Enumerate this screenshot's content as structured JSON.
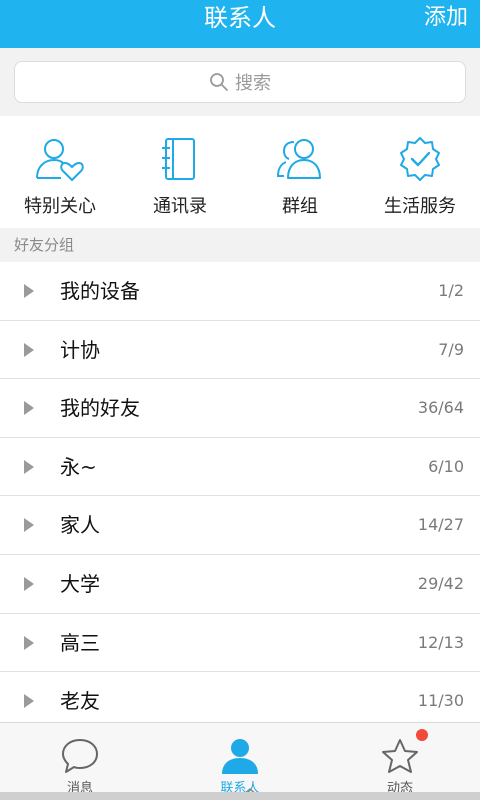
{
  "header": {
    "title": "联系人",
    "add_label": "添加"
  },
  "search": {
    "placeholder": "搜索"
  },
  "quick_actions": [
    {
      "label": "特别关心",
      "icon": "person-heart-icon"
    },
    {
      "label": "通讯录",
      "icon": "address-book-icon"
    },
    {
      "label": "群组",
      "icon": "group-icon"
    },
    {
      "label": "生活服务",
      "icon": "badge-check-icon"
    }
  ],
  "section_title": "好友分组",
  "groups": [
    {
      "name": "我的设备",
      "count": "1/2"
    },
    {
      "name": "计协",
      "count": "7/9"
    },
    {
      "name": "我的好友",
      "count": "36/64"
    },
    {
      "name": "永~",
      "count": "6/10"
    },
    {
      "name": "家人",
      "count": "14/27"
    },
    {
      "name": "大学",
      "count": "29/42"
    },
    {
      "name": "高三",
      "count": "12/13"
    },
    {
      "name": "老友",
      "count": "11/30"
    }
  ],
  "tabs": [
    {
      "label": "消息",
      "icon": "chat-bubble-icon",
      "active": false
    },
    {
      "label": "联系人",
      "icon": "contacts-person-icon",
      "active": true
    },
    {
      "label": "动态",
      "icon": "star-icon",
      "active": false
    }
  ],
  "colors": {
    "accent": "#1fb4f0",
    "badge": "#f04a3a"
  }
}
